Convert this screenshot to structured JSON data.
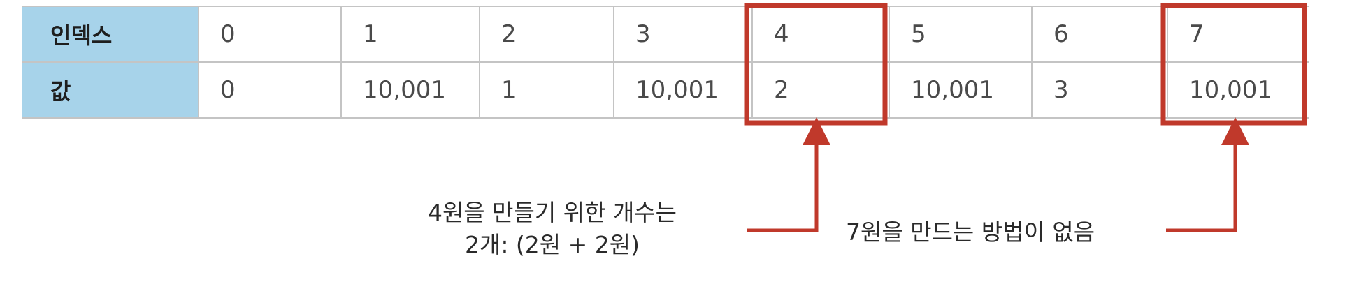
{
  "table": {
    "row_headers": [
      "인덱스",
      "값"
    ],
    "indices": [
      "0",
      "1",
      "2",
      "3",
      "4",
      "5",
      "6",
      "7"
    ],
    "values": [
      "0",
      "10,001",
      "1",
      "10,001",
      "2",
      "10,001",
      "3",
      "10,001"
    ]
  },
  "highlighted_indices": [
    4,
    7
  ],
  "annotations": [
    {
      "target_index": 4,
      "line1": "4원을 만들기 위한 개수는",
      "line2": "2개: (2원 + 2원)"
    },
    {
      "target_index": 7,
      "line1": "7원을 만드는 방법이 없음"
    }
  ],
  "colors": {
    "header_bg": "#a7d3ea",
    "highlight": "#c0392b",
    "grid": "#c4c4c4",
    "text": "#4a4a4a"
  }
}
